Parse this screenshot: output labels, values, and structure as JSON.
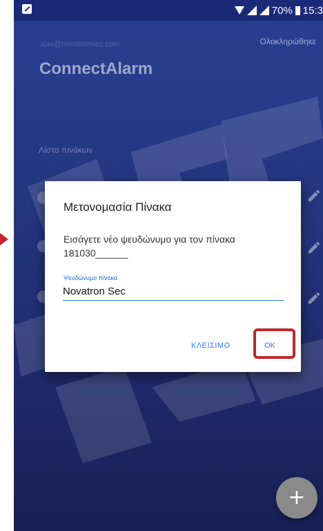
{
  "status_bar": {
    "battery": "70%",
    "time": "15:3"
  },
  "header": {
    "account": "ajax@novatronsec.com",
    "done_label": "Ολοκληρώθηκε",
    "app_title": "ConnectAlarm"
  },
  "list": {
    "title": "Λίστα πινάκων"
  },
  "dialog": {
    "title": "Μετονομασία Πίνακα",
    "message": "Εισάγετε νέο ψευδώνυμο για τον πίνακα 181030______",
    "field_label": "Ψευδώνυμο πίνακα",
    "field_value": "Novatron Sec",
    "close_label": "ΚΛΕΙΣΙΜΟ",
    "ok_label": "OK"
  },
  "fab": {
    "label": "+"
  },
  "colors": {
    "accent": "#2979ff",
    "highlight": "#c0272d",
    "background": "#24357f"
  },
  "icons": [
    "edit-icon",
    "plus-icon",
    "signal-icon",
    "wifi-icon",
    "battery-icon"
  ]
}
